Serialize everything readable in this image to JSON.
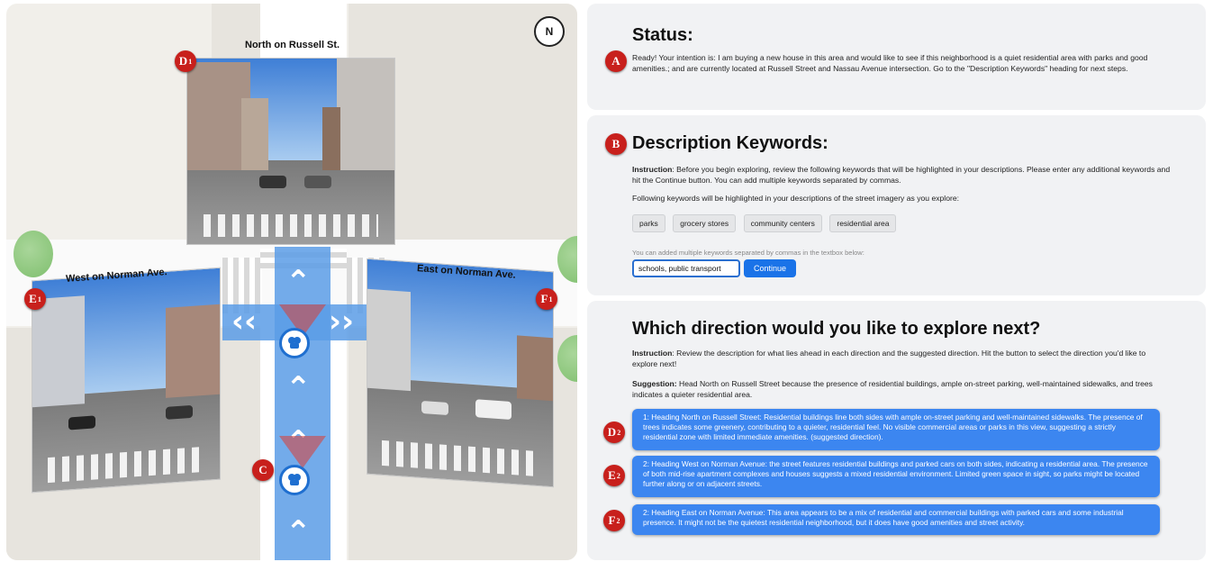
{
  "map": {
    "compass_label": "N",
    "north_label": "North on Russell St.",
    "west_label": "West on Norman Ave.",
    "east_label": "East on Norman Ave.",
    "badges": {
      "A": "A",
      "B": "B",
      "C": "C",
      "D1": "D",
      "D1_sub": "1",
      "E1": "E",
      "E1_sub": "1",
      "F1": "F",
      "F1_sub": "1",
      "D2": "D",
      "D2_sub": "2",
      "E2": "E",
      "E2_sub": "2",
      "F2": "F",
      "F2_sub": "2"
    }
  },
  "status": {
    "heading": "Status:",
    "text": "Ready! Your intention is: I am buying a new house in this area and would like to see if this neighborhood is a quiet residential area with parks and good amenities.; and are currently located at Russell Street and Nassau Avenue intersection. Go to the \"Description Keywords\" heading for next steps."
  },
  "keywords": {
    "heading": "Description Keywords:",
    "instruction_label": "Instruction",
    "instruction": ": Before you begin exploring, review the following keywords that will be highlighted in your descriptions. Please enter any additional keywords and hit the Continue button. You can add multiple keywords separated by commas.",
    "highlight_note": "Following keywords will be highlighted in your descriptions of the street imagery as you explore:",
    "chips": [
      "parks",
      "grocery stores",
      "community centers",
      "residential area"
    ],
    "hint": "You can added multiple keywords separated by commas in the textbox below:",
    "input_value": "schools, public transport",
    "continue_label": "Continue"
  },
  "direction": {
    "heading": "Which direction would you like to explore next?",
    "instruction_label": "Instruction",
    "instruction": ": Review the description for what lies ahead in each direction and the suggested direction. Hit the button to select the direction you'd like to explore next!",
    "suggestion_label": "Suggestion:",
    "suggestion": " Head North on Russell Street because the presence of residential buildings, ample on-street parking, well-maintained sidewalks, and trees indicates a quieter residential area.",
    "options": [
      "1: Heading North on Russell Street: Residential buildings line both sides with ample on-street parking and well-maintained sidewalks. The presence of trees indicates some greenery, contributing to a quieter, residential feel. No visible commercial areas or parks in this view, suggesting a strictly residential zone with limited immediate amenities. (suggested direction).",
      "2: Heading West on Norman Avenue: the street features residential buildings and parked cars on both sides, indicating a residential area. The presence of both mid-rise apartment complexes and houses suggests a mixed residential environment. Limited green space in sight, so parks might be located further along or on adjacent streets.",
      "2: Heading East on Norman Avenue: This area appears to be a mix of residential and commercial buildings with parked cars and some industrial presence. It might not be the quietest residential neighborhood, but it does have good amenities and street activity."
    ]
  },
  "colors": {
    "accent": "#1a73e8",
    "badge": "#c8201c",
    "option_bg": "#3c86f0"
  }
}
